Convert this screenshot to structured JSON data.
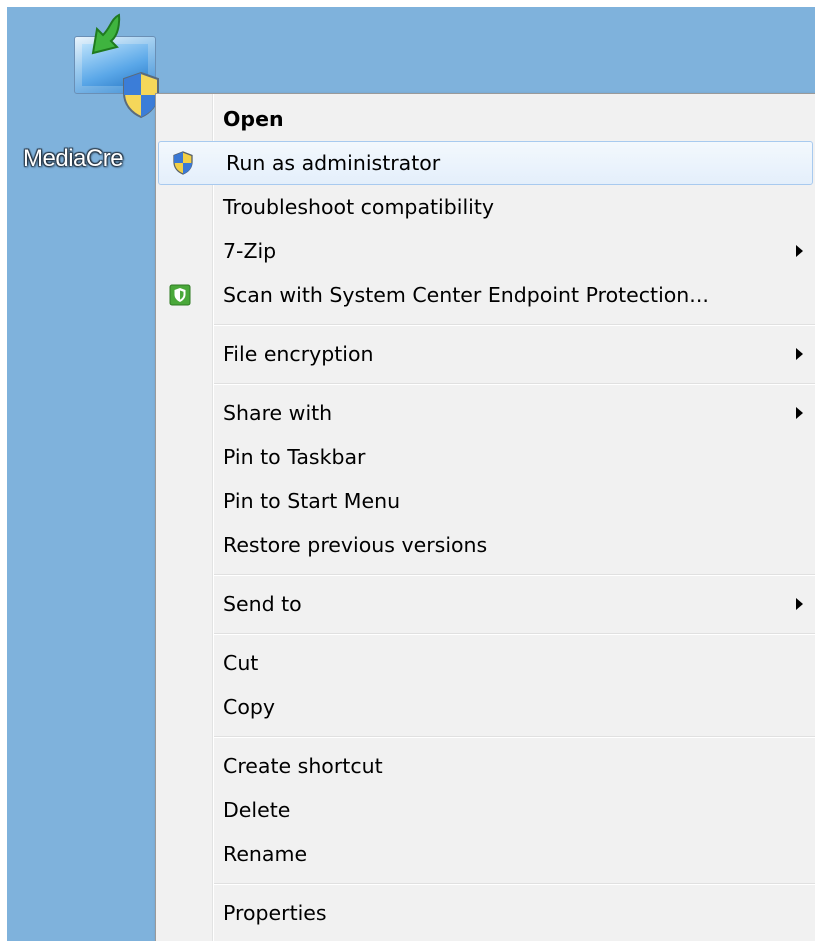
{
  "desktop": {
    "background_color": "#7fb2dc",
    "shortcut": {
      "label": "MediaCre",
      "icon": "media-creation-tool-icon"
    }
  },
  "context_menu": {
    "items": [
      {
        "label": "Open",
        "bold": true
      },
      {
        "label": "Run as administrator",
        "icon": "uac-shield-icon",
        "hovered": true
      },
      {
        "label": "Troubleshoot compatibility"
      },
      {
        "label": "7-Zip",
        "submenu": true
      },
      {
        "label": "Scan with System Center Endpoint Protection...",
        "icon": "endpoint-protection-icon"
      },
      {
        "separator": true
      },
      {
        "label": "File encryption",
        "submenu": true
      },
      {
        "separator": true
      },
      {
        "label": "Share with",
        "submenu": true
      },
      {
        "label": "Pin to Taskbar"
      },
      {
        "label": "Pin to Start Menu"
      },
      {
        "label": "Restore previous versions"
      },
      {
        "separator": true
      },
      {
        "label": "Send to",
        "submenu": true
      },
      {
        "separator": true
      },
      {
        "label": "Cut"
      },
      {
        "label": "Copy"
      },
      {
        "separator": true
      },
      {
        "label": "Create shortcut"
      },
      {
        "label": "Delete"
      },
      {
        "label": "Rename"
      },
      {
        "separator": true
      },
      {
        "label": "Properties"
      }
    ],
    "colors": {
      "menu_background": "#f1f1f1",
      "hover_border": "#a8caef",
      "hover_fill": "#e4effb",
      "text": "#000000"
    }
  }
}
